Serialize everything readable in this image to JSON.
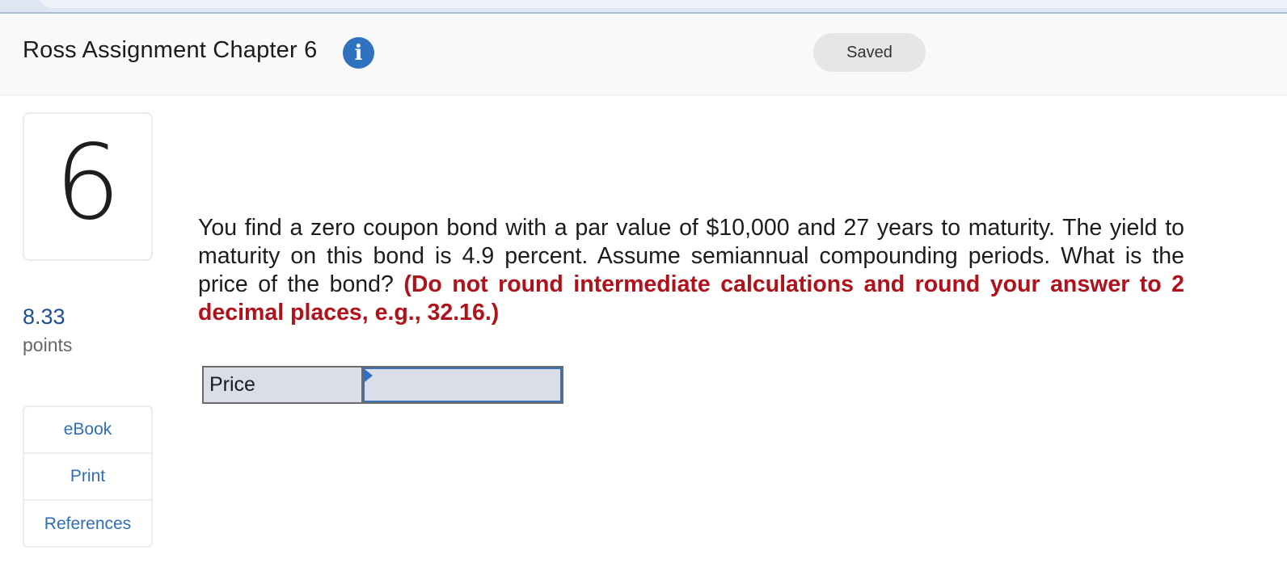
{
  "header": {
    "title": "Ross Assignment Chapter 6",
    "info_icon": "info-icon",
    "status": "Saved"
  },
  "question": {
    "number": "6",
    "points_value": "8.33",
    "points_label": "points",
    "text": "You find a zero coupon bond with a par value of $10,000 and 27 years to maturity. The yield to maturity on this bond is 4.9 percent. Assume semiannual compounding periods. What is the price of the bond? ",
    "instruction": "(Do not round intermediate calculations and round your answer to 2 decimal places, e.g., 32.16.)"
  },
  "resources": [
    {
      "label": "eBook"
    },
    {
      "label": "Print"
    },
    {
      "label": "References"
    }
  ],
  "answer": {
    "label": "Price",
    "value": "",
    "placeholder": ""
  },
  "colors": {
    "accent": "#2f73c0",
    "instruction": "#b0121b",
    "link": "#2f6eb5"
  }
}
